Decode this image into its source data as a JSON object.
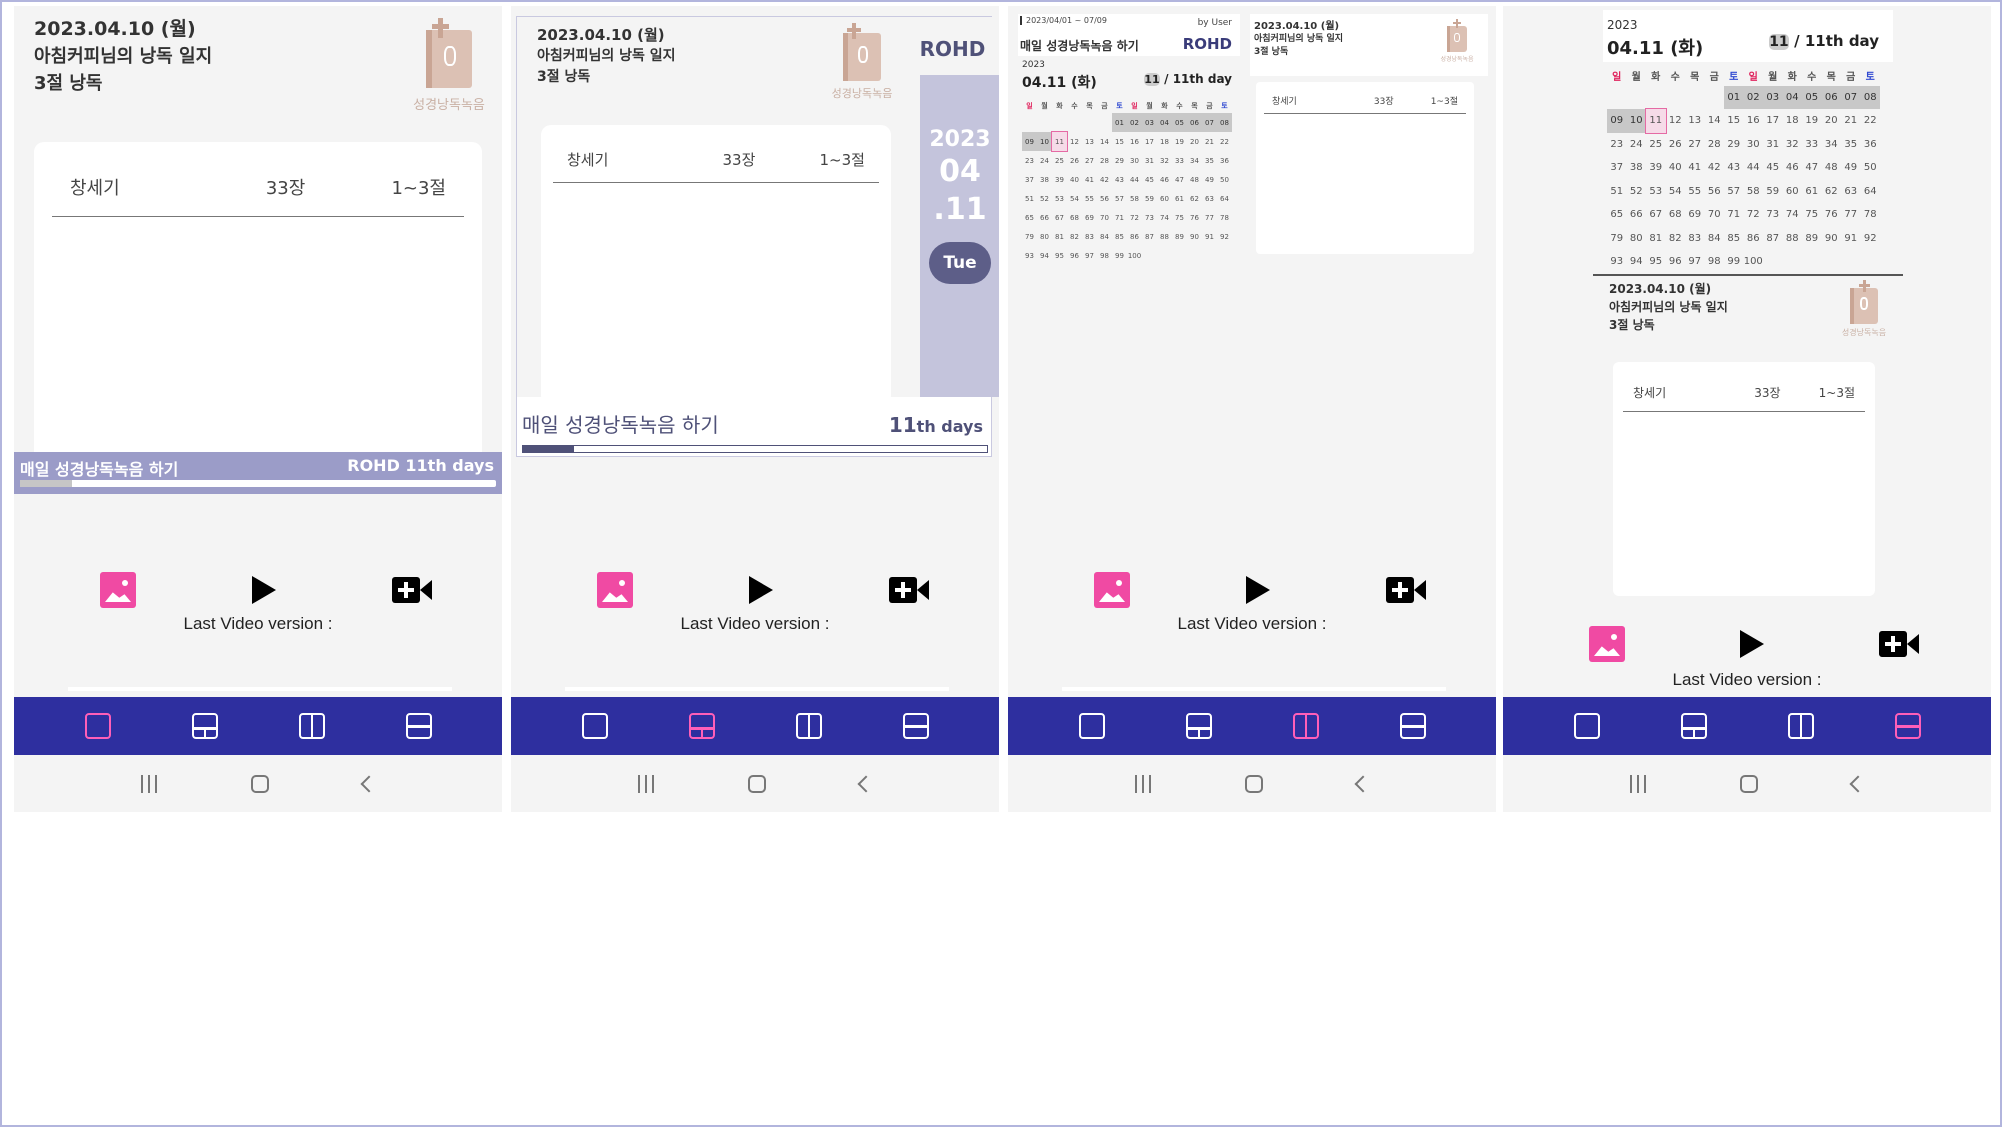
{
  "entry": {
    "date": "2023.04.10 (월)",
    "title": "아침커피님의 낭독 일지",
    "verses": "3절 낭독",
    "book": "창세기",
    "chapter": "33장",
    "verse_range": "1~3절"
  },
  "logo": {
    "caption": "성경낭독녹음"
  },
  "banner": {
    "label": "매일 성경낭독녹음 하기",
    "days": "ROHD 11th days",
    "progress": 0.11
  },
  "p2": {
    "brand": "ROHD",
    "year": "2023",
    "month": "04",
    "day": ".11",
    "weekday": "Tue",
    "bottom_label": "매일 성경낭독녹음 하기",
    "days_num": "11",
    "days_suffix": "th days"
  },
  "calendar": {
    "range": "2023/04/01 ~ 07/09",
    "by": "by User",
    "title": "매일 성경낭독녹음 하기",
    "brand": "ROHD",
    "year": "2023",
    "date": "04.11 (화)",
    "day_num": "11",
    "day_text": "/ 11th day",
    "weekdays": [
      "일",
      "월",
      "화",
      "수",
      "목",
      "금",
      "토",
      "일",
      "월",
      "화",
      "수",
      "목",
      "금",
      "토"
    ],
    "rows": [
      [
        "",
        "",
        "",
        "",
        "",
        "",
        "01",
        "02",
        "03",
        "04",
        "05",
        "06",
        "07",
        "08"
      ],
      [
        "09",
        "10",
        "11",
        "12",
        "13",
        "14",
        "15",
        "16",
        "17",
        "18",
        "19",
        "20",
        "21",
        "22"
      ],
      [
        "23",
        "24",
        "25",
        "26",
        "27",
        "28",
        "29",
        "30",
        "31",
        "32",
        "33",
        "34",
        "35",
        "36"
      ],
      [
        "37",
        "38",
        "39",
        "40",
        "41",
        "42",
        "43",
        "44",
        "45",
        "46",
        "47",
        "48",
        "49",
        "50"
      ],
      [
        "51",
        "52",
        "53",
        "54",
        "55",
        "56",
        "57",
        "58",
        "59",
        "60",
        "61",
        "62",
        "63",
        "64"
      ],
      [
        "65",
        "66",
        "67",
        "68",
        "69",
        "70",
        "71",
        "72",
        "73",
        "74",
        "75",
        "76",
        "77",
        "78"
      ],
      [
        "79",
        "80",
        "81",
        "82",
        "83",
        "84",
        "85",
        "86",
        "87",
        "88",
        "89",
        "90",
        "91",
        "92"
      ],
      [
        "93",
        "94",
        "95",
        "96",
        "97",
        "98",
        "99",
        "100",
        "",
        "",
        "",
        "",
        "",
        ""
      ]
    ]
  },
  "media": {
    "last_video": "Last Video version :"
  },
  "colors": {
    "accent": "#2e2f9f",
    "active": "#ff5fb8",
    "banner": "#9b9cc8",
    "pink": "#f04aa3"
  }
}
